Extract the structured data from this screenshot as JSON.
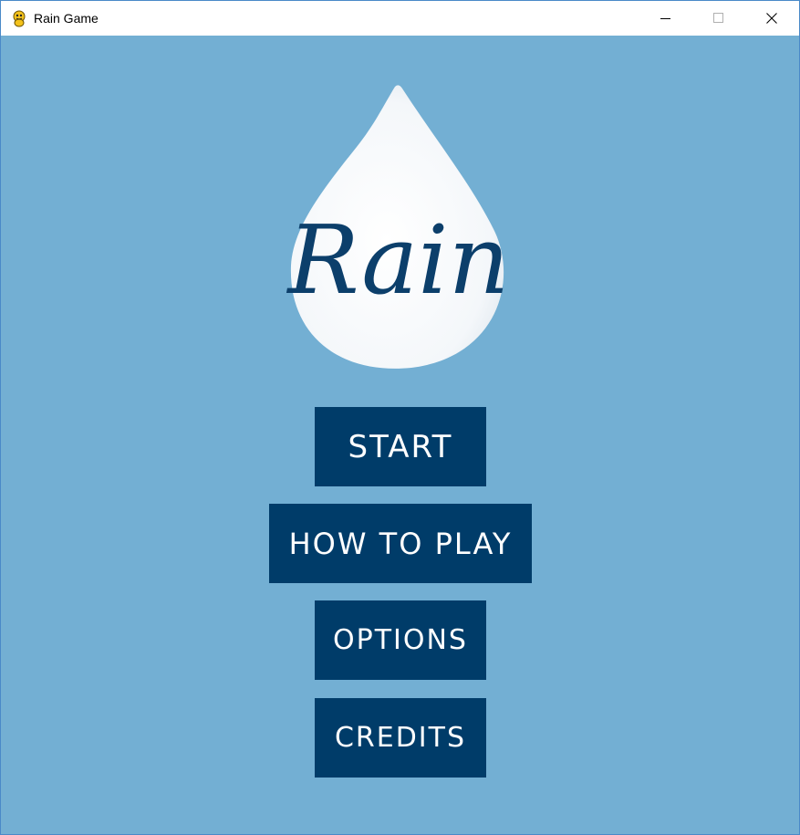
{
  "window": {
    "title": "Rain Game",
    "app_icon": "pygame-snake-icon",
    "controls": {
      "minimize_icon": "minimize-icon",
      "maximize_icon": "maximize-icon",
      "close_icon": "close-icon"
    }
  },
  "game": {
    "background_color": "#73afd3",
    "logo": {
      "icon": "raindrop-icon",
      "text": "Rain",
      "drop_color": "#ffffff",
      "text_color": "#0c3f6b"
    },
    "menu": {
      "button_color": "#003c69",
      "text_color": "#ffffff",
      "items": [
        {
          "label": "START"
        },
        {
          "label": "HOW TO PLAY"
        },
        {
          "label": "OPTIONS"
        },
        {
          "label": "CREDITS"
        }
      ]
    }
  }
}
